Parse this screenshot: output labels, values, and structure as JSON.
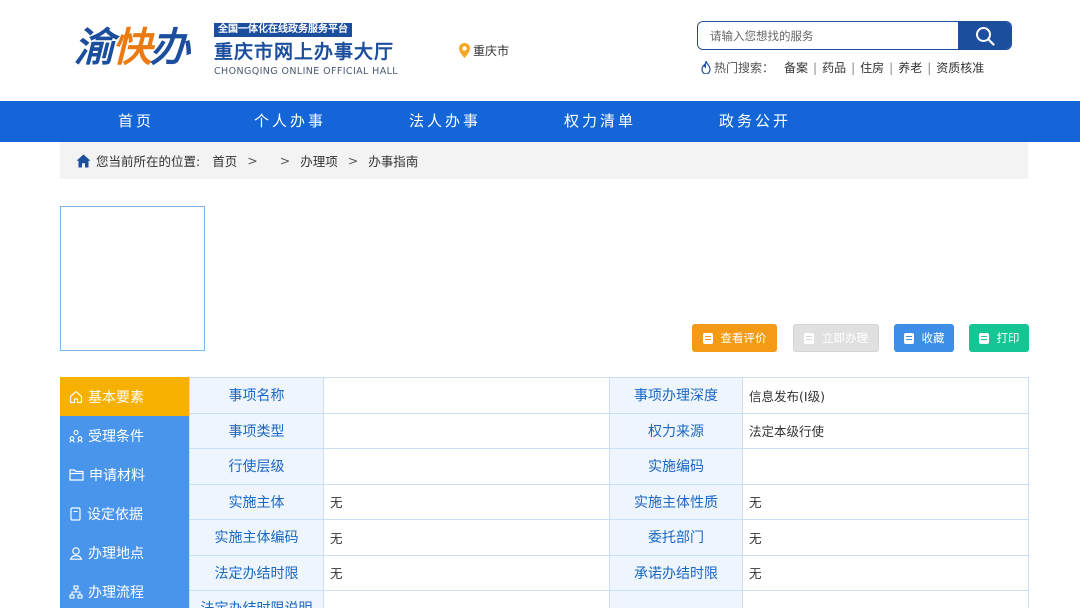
{
  "header": {
    "logo_mark_1": "渝",
    "logo_mark_2": "快",
    "logo_mark_3": "办",
    "badge": "全国一体化在线政务服务平台",
    "title": "重庆市网上办事大厅",
    "title_en": "CHONGQING ONLINE OFFICIAL HALL",
    "location": "重庆市",
    "search_placeholder": "请输入您想找的服务",
    "hot_label": "热门搜索：",
    "hot_keywords": [
      "备案",
      "药品",
      "住房",
      "养老",
      "资质核准"
    ]
  },
  "nav": {
    "items": [
      "首页",
      "个人办事",
      "法人办事",
      "权力清单",
      "政务公开"
    ]
  },
  "breadcrumb": {
    "prefix": "您当前所在的位置:",
    "home": "首页",
    "arrow": ">",
    "item1": "办理项",
    "item2": "办事指南"
  },
  "actions": {
    "review": "查看评价",
    "apply": "立即办理",
    "favorite": "收藏",
    "print": "打印"
  },
  "side_menu": {
    "items": [
      "基本要素",
      "受理条件",
      "申请材料",
      "设定依据",
      "办理地点",
      "办理流程"
    ]
  },
  "table": {
    "rows": [
      {
        "k1": "事项名称",
        "v1": "",
        "k2": "事项办理深度",
        "v2": "信息发布(Ⅰ级)"
      },
      {
        "k1": "事项类型",
        "v1": "",
        "k2": "权力来源",
        "v2": "法定本级行使"
      },
      {
        "k1": "行使层级",
        "v1": "",
        "k2": "实施编码",
        "v2": ""
      },
      {
        "k1": "实施主体",
        "v1": "无",
        "k2": "实施主体性质",
        "v2": "无"
      },
      {
        "k1": "实施主体编码",
        "v1": "无",
        "k2": "委托部门",
        "v2": "无"
      },
      {
        "k1": "法定办结时限",
        "v1": "无",
        "k2": "承诺办结时限",
        "v2": "无"
      },
      {
        "k1": "法定办结时限说明",
        "v1": "",
        "k2": "",
        "v2": ""
      }
    ]
  },
  "colors": {
    "brand_blue": "#1c4e9e",
    "nav_blue": "#1466d8",
    "side_blue": "#4a95ec",
    "active_yellow": "#f6b000",
    "review_orange": "#f59a17",
    "favorite_blue": "#3c8ee6",
    "print_green": "#16c594"
  }
}
